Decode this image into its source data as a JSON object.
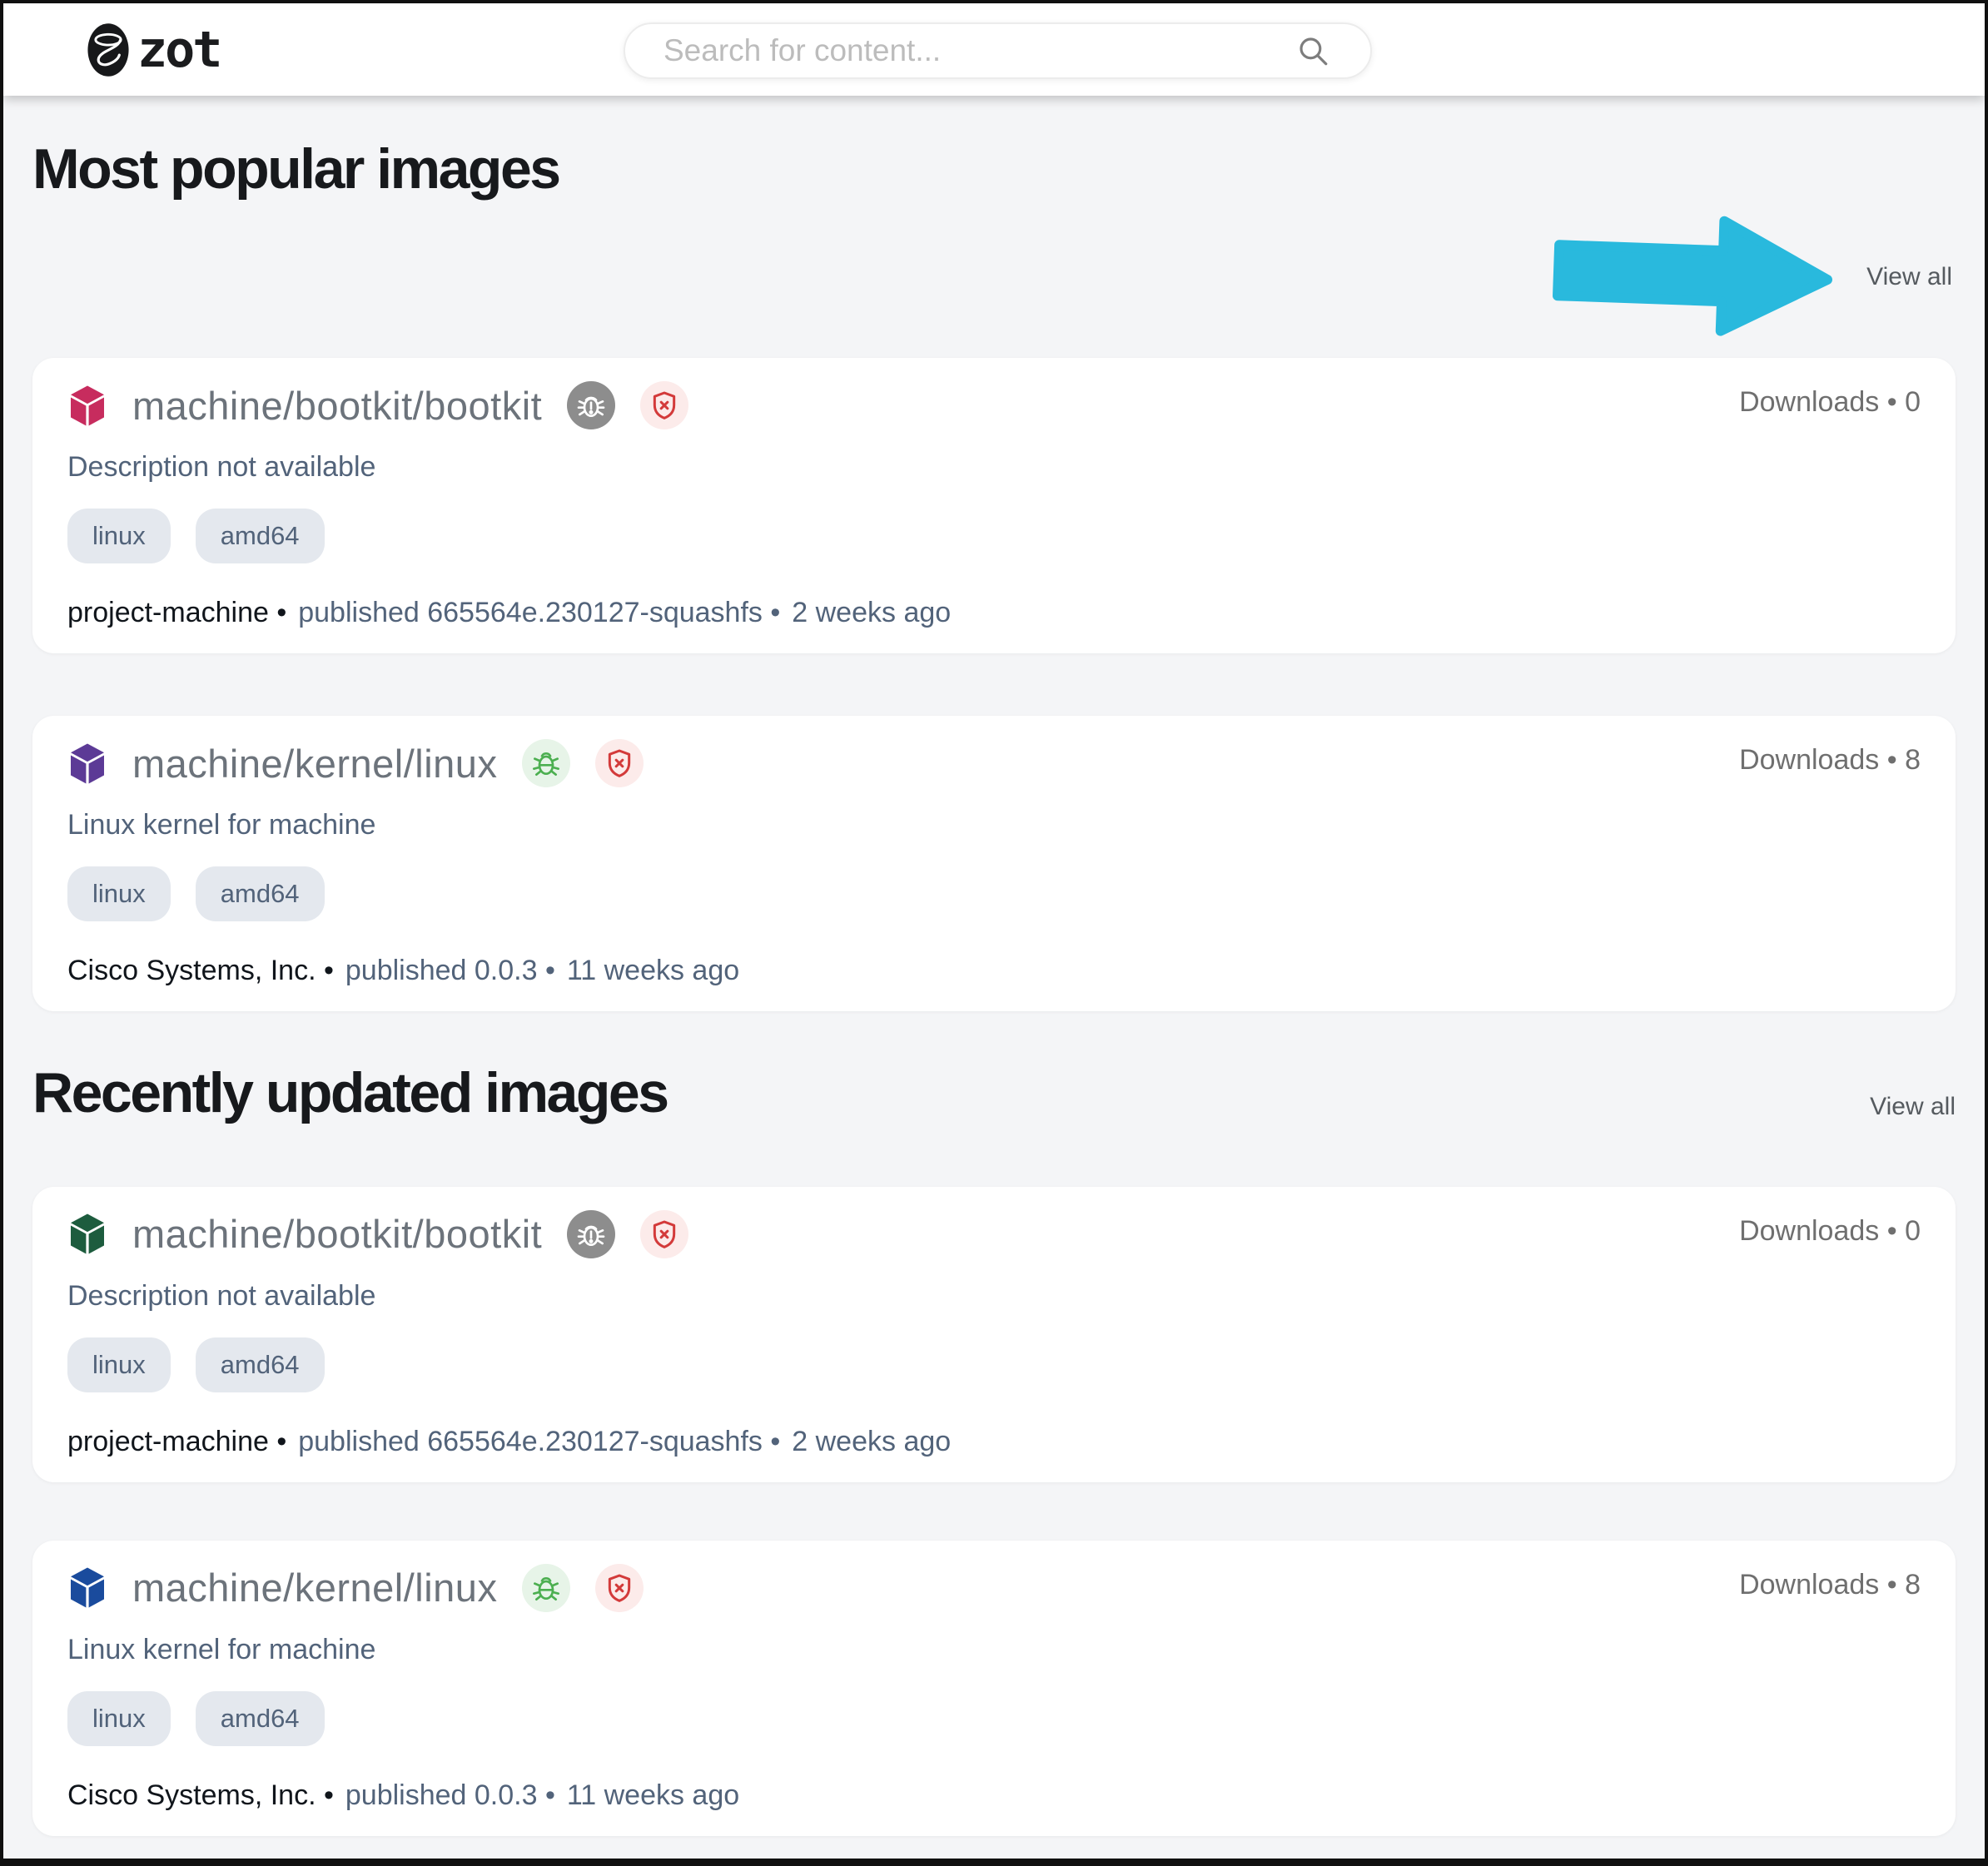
{
  "header": {
    "logo_text": "zot",
    "search": {
      "placeholder": "Search for content..."
    }
  },
  "annotation": {
    "arrow_color": "#29b9dd"
  },
  "sections": [
    {
      "title": "Most popular images",
      "view_all_label": "View all",
      "cards": [
        {
          "name": "machine/bootkit/bootkit",
          "cube_color": "#c72c5e",
          "scan_badge": {
            "status": "scan-not-supported",
            "fg": "#ffffff",
            "bg": "#8d8d8d"
          },
          "signature_badge": {
            "status": "unsigned",
            "fg": "#d33a3a",
            "bg": "#fcebea"
          },
          "downloads_text": "Downloads • 0",
          "description": "Description not available",
          "tags": [
            "linux",
            "amd64"
          ],
          "publisher": "project-machine •",
          "published": "published 665564e.230127-squashfs •",
          "updated": "2 weeks ago"
        },
        {
          "name": "machine/kernel/linux",
          "cube_color": "#5c3a96",
          "scan_badge": {
            "status": "no-vulnerabilities",
            "fg": "#4caf50",
            "bg": "#e7f4e8"
          },
          "signature_badge": {
            "status": "unsigned",
            "fg": "#d33a3a",
            "bg": "#fcebea"
          },
          "downloads_text": "Downloads • 8",
          "description": "Linux kernel for machine",
          "tags": [
            "linux",
            "amd64"
          ],
          "publisher": "Cisco Systems, Inc. •",
          "published": "published 0.0.3 •",
          "updated": "11 weeks ago"
        }
      ]
    },
    {
      "title": "Recently updated images",
      "view_all_label": "View all",
      "cards": [
        {
          "name": "machine/bootkit/bootkit",
          "cube_color": "#1d5c3e",
          "scan_badge": {
            "status": "scan-not-supported",
            "fg": "#ffffff",
            "bg": "#8d8d8d"
          },
          "signature_badge": {
            "status": "unsigned",
            "fg": "#d33a3a",
            "bg": "#fcebea"
          },
          "downloads_text": "Downloads • 0",
          "description": "Description not available",
          "tags": [
            "linux",
            "amd64"
          ],
          "publisher": "project-machine •",
          "published": "published 665564e.230127-squashfs •",
          "updated": "2 weeks ago"
        },
        {
          "name": "machine/kernel/linux",
          "cube_color": "#1a4b9d",
          "scan_badge": {
            "status": "no-vulnerabilities",
            "fg": "#4caf50",
            "bg": "#e7f4e8"
          },
          "signature_badge": {
            "status": "unsigned",
            "fg": "#d33a3a",
            "bg": "#fcebea"
          },
          "downloads_text": "Downloads • 8",
          "description": "Linux kernel for machine",
          "tags": [
            "linux",
            "amd64"
          ],
          "publisher": "Cisco Systems, Inc. •",
          "published": "published 0.0.3 •",
          "updated": "11 weeks ago"
        }
      ]
    }
  ]
}
